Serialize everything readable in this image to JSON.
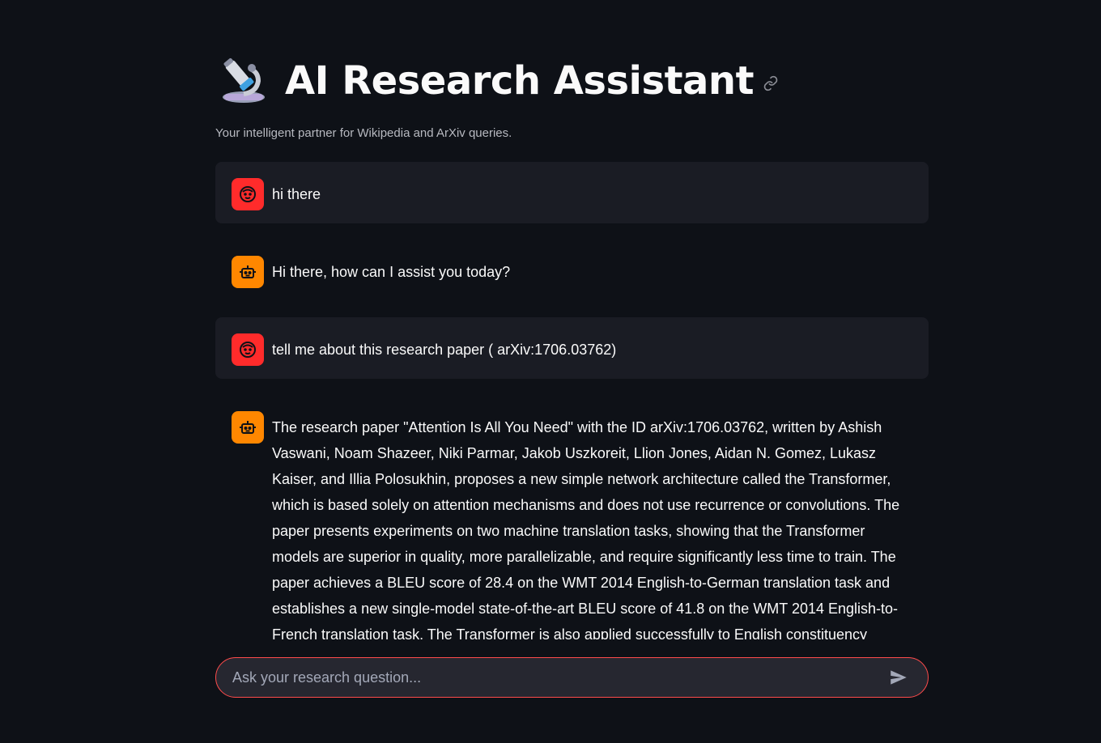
{
  "header": {
    "title": "AI Research Assistant",
    "subtitle": "Your intelligent partner for Wikipedia and ArXiv queries.",
    "title_icon": "microscope-icon"
  },
  "messages": [
    {
      "role": "user",
      "text": "hi there"
    },
    {
      "role": "assistant",
      "text": "Hi there, how can I assist you today?"
    },
    {
      "role": "user",
      "text": "tell me about this research paper ( arXiv:1706.03762)"
    },
    {
      "role": "assistant",
      "text": "The research paper \"Attention Is All You Need\" with the ID arXiv:1706.03762, written by Ashish Vaswani, Noam Shazeer, Niki Parmar, Jakob Uszkoreit, Llion Jones, Aidan N. Gomez, Lukasz Kaiser, and Illia Polosukhin, proposes a new simple network architecture called the Transformer, which is based solely on attention mechanisms and does not use recurrence or convolutions. The paper presents experiments on two machine translation tasks, showing that the Transformer models are superior in quality, more parallelizable, and require significantly less time to train. The paper achieves a BLEU score of 28.4 on the WMT 2014 English-to-German translation task and establishes a new single-model state-of-the-art BLEU score of 41.8 on the WMT 2014 English-to-French translation task. The Transformer is also applied successfully to English constituency"
    }
  ],
  "chat_input": {
    "placeholder": "Ask your research question..."
  },
  "colors": {
    "background": "#0e1117",
    "user_avatar": "#ff2b2b",
    "assistant_avatar": "#ff8700",
    "input_border": "#ff4b4b"
  }
}
